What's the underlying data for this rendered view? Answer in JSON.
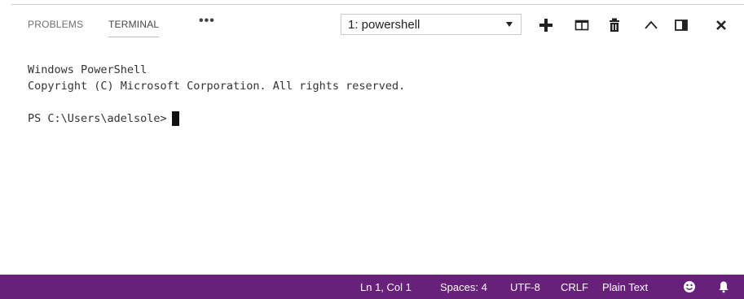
{
  "panel": {
    "tabs": [
      {
        "label": "PROBLEMS"
      },
      {
        "label": "TERMINAL"
      }
    ],
    "more_label": "•••",
    "terminal_select": {
      "value": "1: powershell"
    },
    "actions": [
      "plus-icon",
      "split-icon",
      "trash-icon",
      "chevron-up-icon",
      "maximize-panel-icon",
      "close-icon"
    ]
  },
  "terminal": {
    "lines": [
      "Windows PowerShell",
      "Copyright (C) Microsoft Corporation. All rights reserved."
    ],
    "prompt": "PS C:\\Users\\adelsole>"
  },
  "status_bar": {
    "background": "#68217a",
    "position": "Ln 1, Col 1",
    "spaces": "Spaces: 4",
    "encoding": "UTF-8",
    "eol": "CRLF",
    "language": "Plain Text",
    "icons": [
      "smiley-icon",
      "bell-icon"
    ]
  }
}
